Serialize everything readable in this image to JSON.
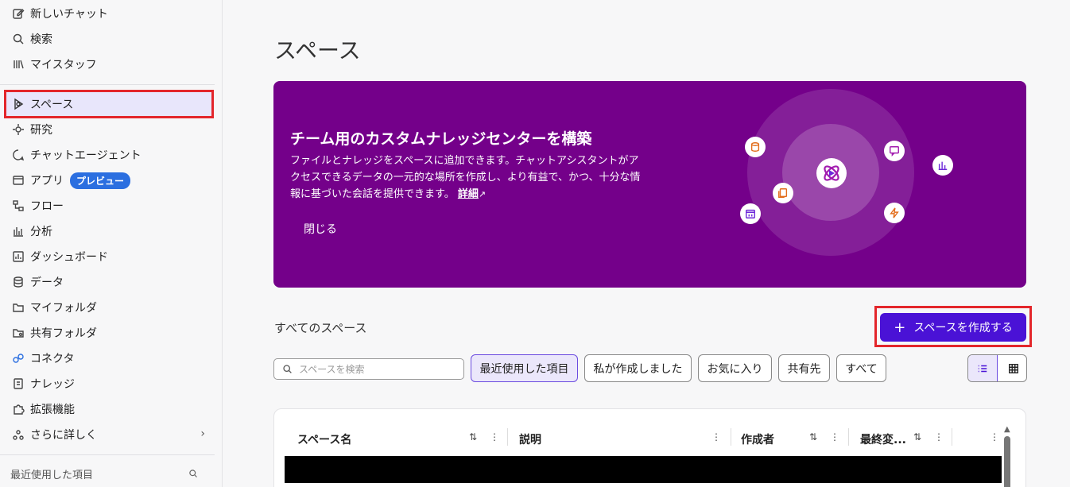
{
  "sidebar": {
    "items": [
      {
        "label": "新しいチャット",
        "icon": "edit-icon"
      },
      {
        "label": "検索",
        "icon": "search-icon"
      },
      {
        "label": "マイスタッフ",
        "icon": "library-icon"
      },
      {
        "label": "スペース",
        "icon": "space-icon",
        "active": true
      },
      {
        "label": "研究",
        "icon": "research-icon"
      },
      {
        "label": "チャットエージェント",
        "icon": "agent-icon"
      },
      {
        "label": "アプリ",
        "icon": "app-icon",
        "badge": "プレビュー"
      },
      {
        "label": "フロー",
        "icon": "flow-icon"
      },
      {
        "label": "分析",
        "icon": "analytics-icon"
      },
      {
        "label": "ダッシュボード",
        "icon": "dashboard-icon"
      },
      {
        "label": "データ",
        "icon": "database-icon"
      },
      {
        "label": "マイフォルダ",
        "icon": "folder-icon"
      },
      {
        "label": "共有フォルダ",
        "icon": "shared-folder-icon"
      },
      {
        "label": "コネクタ",
        "icon": "connector-icon"
      },
      {
        "label": "ナレッジ",
        "icon": "knowledge-icon"
      },
      {
        "label": "拡張機能",
        "icon": "puzzle-icon"
      },
      {
        "label": "さらに詳しく",
        "icon": "more-icon"
      }
    ],
    "recent_label": "最近使用した項目"
  },
  "main": {
    "title": "スペース",
    "banner": {
      "title": "チーム用のカスタムナレッジセンターを構築",
      "description": "ファイルとナレッジをスペースに追加できます。チャットアシスタントがアクセスできるデータの一元的な場所を作成し、より有益で、かつ、十分な情報に基づいた会話を提供できます。",
      "link": "詳細",
      "close": "閉じる",
      "bg_color": "#74008a"
    },
    "section_title": "すべてのスペース",
    "create_button": "スペースを作成する",
    "search_placeholder": "スペースを検索",
    "filters": [
      "最近使用した項目",
      "私が作成しました",
      "お気に入り",
      "共有先",
      "すべて"
    ],
    "table_headers": [
      "スペース名",
      "説明",
      "作成者",
      "最終変..."
    ],
    "accent_color": "#4a12d6",
    "highlight_color": "#e3262b"
  }
}
